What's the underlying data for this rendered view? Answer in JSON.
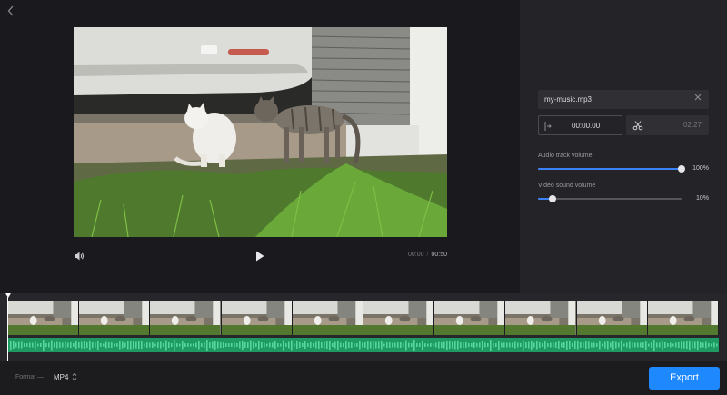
{
  "player": {
    "current_time": "00:00",
    "separator": "/",
    "total_time": "00:50"
  },
  "audio_panel": {
    "file_name": "my-music.mp3",
    "start_time": "00:00.00",
    "end_time": "02:27",
    "audio_track_label": "Audio track volume",
    "audio_track_value": "100%",
    "audio_track_level": 1.0,
    "video_sound_label": "Video sound volume",
    "video_sound_value": "10%",
    "video_sound_level": 0.1
  },
  "timeline": {
    "frame_count": 10
  },
  "footer": {
    "format_label": "Format —",
    "format_value": "MP4",
    "export_label": "Export"
  },
  "colors": {
    "accent": "#1e88ff",
    "slider_fill": "#3b82f6",
    "audio_track": "#1f9a63",
    "audio_wave": "#55d69a"
  },
  "icons": {
    "back": "chevron-left-icon",
    "volume": "speaker-icon",
    "play": "play-icon",
    "close": "close-icon",
    "start_marker": "start-marker-icon",
    "cut": "scissors-icon",
    "format_toggle": "chevron-up-down-icon"
  }
}
